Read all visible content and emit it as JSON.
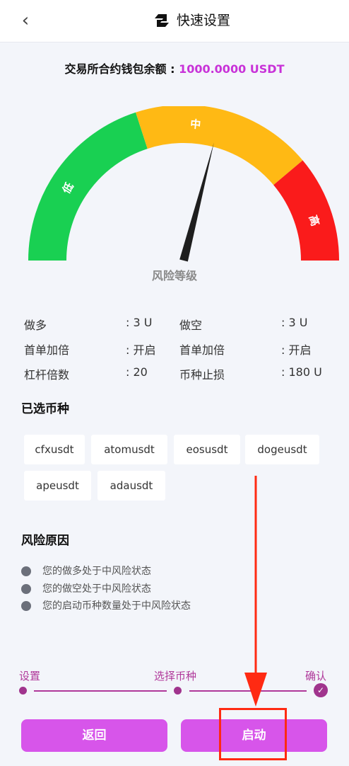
{
  "header": {
    "back_icon": "chevron-left-icon",
    "logo_icon": "app-logo-icon",
    "title": "快速设置"
  },
  "balance": {
    "label": "交易所合约钱包余额 :",
    "value": "1000.0000 USDT"
  },
  "gauge": {
    "low_label": "低",
    "mid_label": "中",
    "high_label": "高",
    "caption": "风险等级",
    "level": 0.58,
    "colors": {
      "low": "#19d052",
      "mid": "#ffb914",
      "high": "#fa1b1b",
      "needle": "#1e1e1e"
    }
  },
  "params": [
    {
      "k1": "做多",
      "v1": ": 3 U",
      "k2": "做空",
      "v2": ": 3 U"
    },
    {
      "k1": "首单加倍",
      "v1": ": 开启",
      "k2": "首单加倍",
      "v2": ": 开启"
    },
    {
      "k1": "杠杆倍数",
      "v1": ": 20",
      "k2": "币种止损",
      "v2": ": 180 U"
    }
  ],
  "coins_title": "已选币种",
  "coins": [
    "cfxusdt",
    "atomusdt",
    "eosusdt",
    "dogeusdt",
    "apeusdt",
    "adausdt"
  ],
  "reasons_title": "风险原因",
  "reasons": [
    "您的做多处于中风险状态",
    "您的做空处于中风险状态",
    "您的启动币种数量处于中风险状态"
  ],
  "steps": [
    "设置",
    "选择币种",
    "确认"
  ],
  "buttons": {
    "back": "返回",
    "start": "启动"
  },
  "colors": {
    "accent": "#d755ea",
    "step": "#b0389a",
    "annotation": "#ff2a12"
  }
}
